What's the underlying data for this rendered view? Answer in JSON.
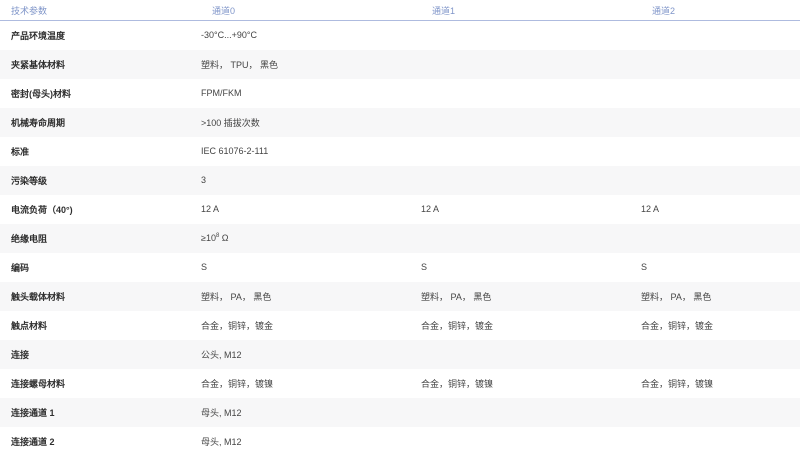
{
  "header": {
    "param": "技术参数",
    "ch0": "通道0",
    "ch1": "通道1",
    "ch2": "通道2"
  },
  "rows": [
    {
      "label": "产品环境温度",
      "v0": "-30°C...+90°C",
      "v1": "",
      "v2": ""
    },
    {
      "label": "夹紧基体材料",
      "v0": "塑料， TPU， 黑色",
      "v1": "",
      "v2": ""
    },
    {
      "label": "密封(母头)材料",
      "v0": "FPM/FKM",
      "v1": "",
      "v2": ""
    },
    {
      "label": "机械寿命周期",
      "v0": ">100 插拔次数",
      "v1": "",
      "v2": ""
    },
    {
      "label": "标准",
      "v0": "IEC 61076-2-111",
      "v1": "",
      "v2": ""
    },
    {
      "label": "污染等级",
      "v0": "3",
      "v1": "",
      "v2": ""
    },
    {
      "label": "电流负荷（40°)",
      "v0": "12 A",
      "v1": "12 A",
      "v2": "12 A"
    },
    {
      "label": "绝缘电阻",
      "v0_base": "≥10",
      "v0_exp": "8",
      "v0_unit": " Ω",
      "v1": "",
      "v2": ""
    },
    {
      "label": "编码",
      "v0": "S",
      "v1": "S",
      "v2": "S"
    },
    {
      "label": "触头载体材料",
      "v0": "塑料， PA， 黑色",
      "v1": "塑料， PA， 黑色",
      "v2": "塑料， PA， 黑色"
    },
    {
      "label": "触点材料",
      "v0": "合金，铜锌，镀金",
      "v1": "合金，铜锌，镀金",
      "v2": "合金，铜锌，镀金"
    },
    {
      "label": "连接",
      "v0": "公头, M12",
      "v1": "",
      "v2": ""
    },
    {
      "label": "连接螺母材料",
      "v0": "合金，铜锌，镀镍",
      "v1": "合金，铜锌，镀镍",
      "v2": "合金，铜锌，镀镍"
    },
    {
      "label": "连接通道 1",
      "v0": "母头, M12",
      "v1": "",
      "v2": ""
    },
    {
      "label": "连接通道 2",
      "v0": "母头, M12",
      "v1": "",
      "v2": ""
    }
  ]
}
